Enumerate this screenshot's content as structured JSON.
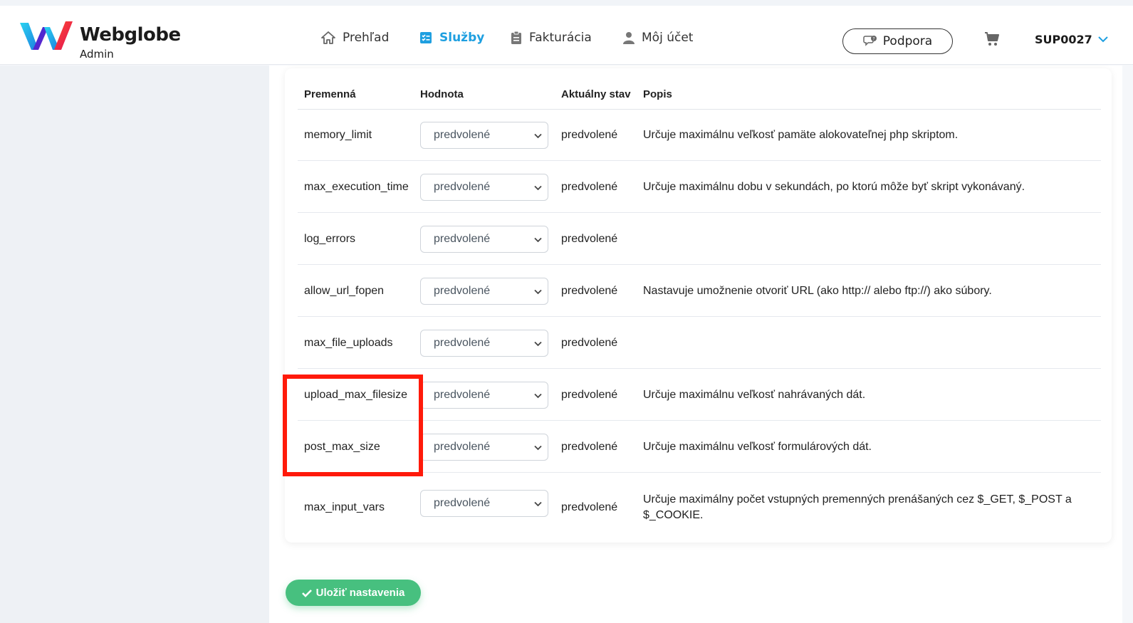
{
  "brand": {
    "name": "Webglobe",
    "sub": "Admin"
  },
  "nav": [
    {
      "label": "Prehľad",
      "icon": "home-icon"
    },
    {
      "label": "Služby",
      "icon": "services-icon",
      "active": true
    },
    {
      "label": "Fakturácia",
      "icon": "clipboard-icon"
    },
    {
      "label": "Môj účet",
      "icon": "user-icon"
    }
  ],
  "header": {
    "support_label": "Podpora",
    "account_label": "SUP0027"
  },
  "table": {
    "columns": {
      "var": "Premenná",
      "value": "Hodnota",
      "state": "Aktuálny stav",
      "desc": "Popis"
    },
    "rows": [
      {
        "var": "memory_limit",
        "value": "predvolené",
        "state": "predvolené",
        "desc": "Určuje maximálnu veľkosť pamäte alokovateľnej php skriptom."
      },
      {
        "var": "max_execution_time",
        "value": "predvolené",
        "state": "predvolené",
        "desc": "Určuje maximálnu dobu v sekundách, po ktorú môže byť skript vykonávaný."
      },
      {
        "var": "log_errors",
        "value": "predvolené",
        "state": "predvolené",
        "desc": ""
      },
      {
        "var": "allow_url_fopen",
        "value": "predvolené",
        "state": "predvolené",
        "desc": "Nastavuje umožnenie otvoriť URL (ako http:// alebo ftp://) ako súbory."
      },
      {
        "var": "max_file_uploads",
        "value": "predvolené",
        "state": "predvolené",
        "desc": ""
      },
      {
        "var": "upload_max_filesize",
        "value": "predvolené",
        "state": "predvolené",
        "desc": "Určuje maximálnu veľkosť nahrávaných dát."
      },
      {
        "var": "post_max_size",
        "value": "predvolené",
        "state": "predvolené",
        "desc": "Určuje maximálnu veľkosť formulárových dát."
      },
      {
        "var": "max_input_vars",
        "value": "predvolené",
        "state": "predvolené",
        "desc": "Určuje maximálny počet vstupných premenných prenášaných cez $_GET, $_POST a $_COOKIE."
      }
    ]
  },
  "actions": {
    "save_label": "Uložiť nastavenia"
  },
  "colors": {
    "accent": "#1e9fe0",
    "save": "#47c07f",
    "highlight": "#ff1a0a"
  }
}
